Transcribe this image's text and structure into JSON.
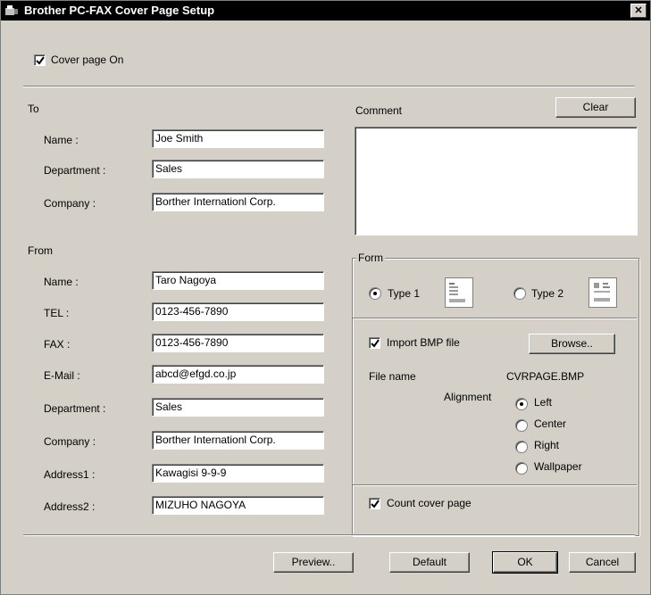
{
  "window": {
    "title": "Brother PC-FAX Cover Page Setup",
    "close_glyph": "✕"
  },
  "cover_page": {
    "label": "Cover page On",
    "checked": true
  },
  "to": {
    "heading": "To",
    "name_label": "Name :",
    "name_value": "Joe Smith",
    "department_label": "Department :",
    "department_value": "Sales",
    "company_label": "Company :",
    "company_value": "Borther Internationl Corp."
  },
  "from": {
    "heading": "From",
    "name_label": "Name :",
    "name_value": "Taro Nagoya",
    "tel_label": "TEL :",
    "tel_value": "0123-456-7890",
    "fax_label": "FAX :",
    "fax_value": "0123-456-7890",
    "email_label": "E-Mail :",
    "email_value": "abcd@efgd.co.jp",
    "department_label": "Department :",
    "department_value": "Sales",
    "company_label": "Company :",
    "company_value": "Borther Internationl Corp.",
    "address1_label": "Address1 :",
    "address1_value": "Kawagisi 9-9-9",
    "address2_label": "Address2 :",
    "address2_value": "MIZUHO NAGOYA"
  },
  "comment": {
    "label": "Comment",
    "clear_button": "Clear",
    "value": ""
  },
  "form": {
    "legend": "Form",
    "type1_label": "Type 1",
    "type2_label": "Type 2",
    "selected_type": "Type 1"
  },
  "bmp": {
    "import_label": "Import BMP file",
    "import_checked": true,
    "browse_button": "Browse..",
    "file_name_label": "File name",
    "file_name_value": "CVRPAGE.BMP",
    "alignment_label": "Alignment",
    "alignment_options": [
      "Left",
      "Center",
      "Right",
      "Wallpaper"
    ],
    "alignment_selected": "Left"
  },
  "count_cover_page": {
    "label": "Count cover page",
    "checked": true
  },
  "buttons": {
    "preview": "Preview..",
    "default": "Default",
    "ok": "OK",
    "cancel": "Cancel"
  }
}
